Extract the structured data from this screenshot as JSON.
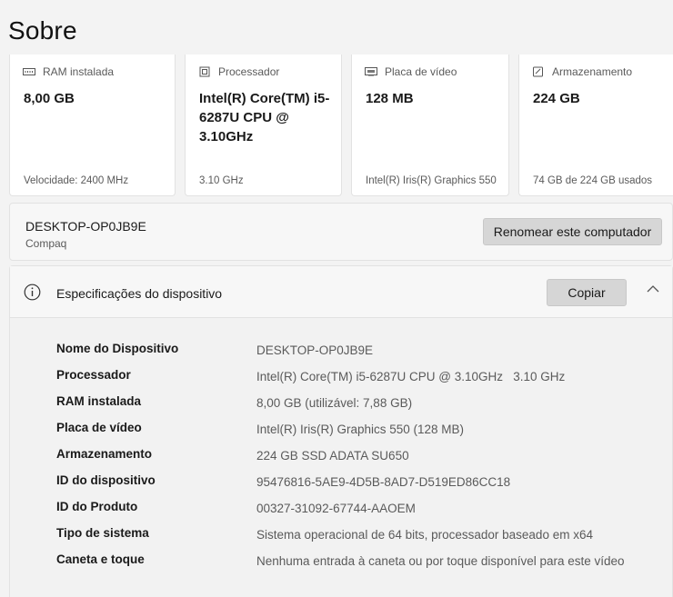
{
  "page": {
    "title": "Sobre"
  },
  "cards": [
    {
      "label": "RAM instalada",
      "value": "8,00 GB",
      "sub": "Velocidade: 2400 MHz",
      "icon": "ram-icon"
    },
    {
      "label": "Processador",
      "value": "Intel(R) Core(TM) i5-6287U CPU @ 3.10GHz",
      "sub": "3.10 GHz",
      "icon": "processor-icon"
    },
    {
      "label": "Placa de vídeo",
      "value": "128 MB",
      "sub": "Intel(R) Iris(R) Graphics 550",
      "icon": "gpu-icon"
    },
    {
      "label": "Armazenamento",
      "value": "224 GB",
      "sub": "74 GB de 224 GB usados",
      "icon": "storage-icon"
    }
  ],
  "computer": {
    "name": "DESKTOP-OP0JB9E",
    "brand": "Compaq",
    "rename_label": "Renomear este computador"
  },
  "specs": {
    "title": "Especificações do dispositivo",
    "copy_label": "Copiar",
    "rows": [
      {
        "key": "Nome do Dispositivo",
        "value": "DESKTOP-OP0JB9E"
      },
      {
        "key": "Processador",
        "value": "Intel(R) Core(TM) i5-6287U CPU @ 3.10GHz   3.10 GHz"
      },
      {
        "key": "RAM instalada",
        "value": "8,00 GB (utilizável: 7,88 GB)"
      },
      {
        "key": "Placa de vídeo",
        "value": "Intel(R) Iris(R) Graphics 550 (128 MB)"
      },
      {
        "key": "Armazenamento",
        "value": "224 GB SSD ADATA SU650"
      },
      {
        "key": "ID do dispositivo",
        "value": "95476816-5AE9-4D5B-8AD7-D519ED86CC18"
      },
      {
        "key": "ID do Produto",
        "value": "00327-31092-67744-AAOEM"
      },
      {
        "key": "Tipo de sistema",
        "value": "Sistema operacional de 64 bits, processador baseado em x64"
      },
      {
        "key": "Caneta e toque",
        "value": "Nenhuma entrada à caneta ou por toque disponível para este vídeo"
      }
    ]
  }
}
